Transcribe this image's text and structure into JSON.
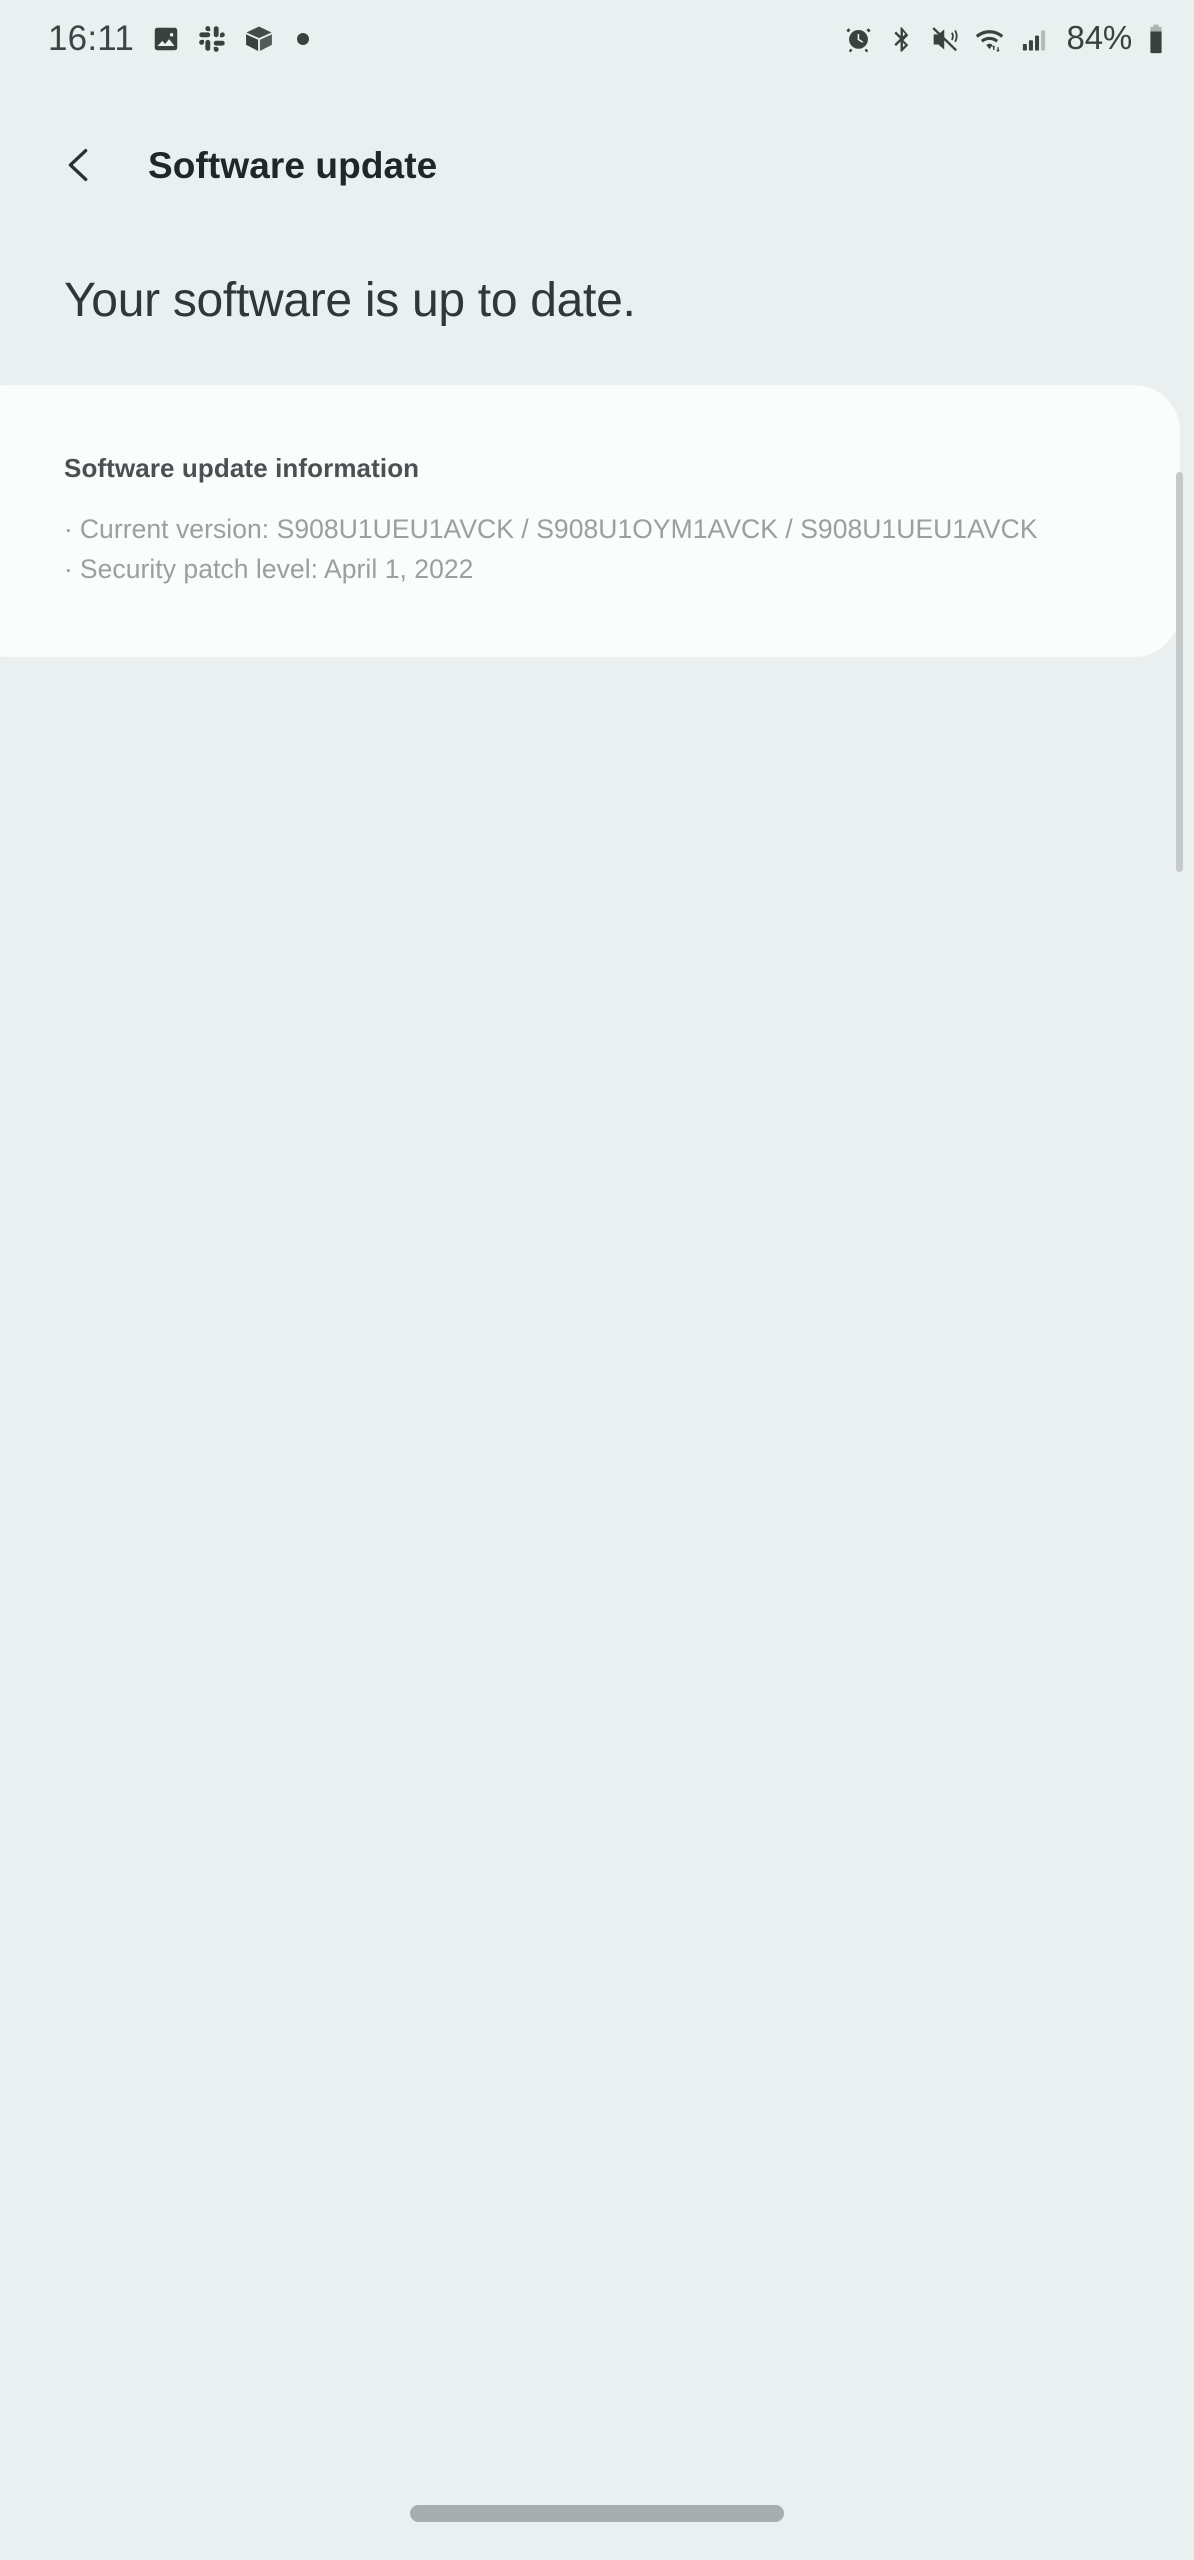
{
  "status_bar": {
    "clock": "16:11",
    "battery_percent": "84%",
    "left_icons": [
      {
        "name": "photos-icon",
        "label": "Photos"
      },
      {
        "name": "slack-icon",
        "label": "Slack"
      },
      {
        "name": "package-icon",
        "label": "Package"
      },
      {
        "name": "more-dot-icon",
        "label": "More"
      }
    ],
    "right_icons": [
      {
        "name": "alarm-icon",
        "label": "Alarm"
      },
      {
        "name": "bluetooth-icon",
        "label": "Bluetooth"
      },
      {
        "name": "mute-vibrate-icon",
        "label": "Mute"
      },
      {
        "name": "wifi-icon",
        "label": "Wi-Fi"
      },
      {
        "name": "cellular-signal-icon",
        "label": "Signal"
      },
      {
        "name": "battery-icon",
        "label": "Battery"
      }
    ]
  },
  "toolbar": {
    "back_label": "Back",
    "title": "Software update"
  },
  "main": {
    "headline": "Your software is up to date.",
    "card": {
      "title": "Software update information",
      "lines": [
        "Current version: S908U1UEU1AVCK / S908U1OYM1AVCK / S908U1UEU1AVCK",
        "Security patch level: April 1, 2022"
      ],
      "bullet_char": "·"
    }
  },
  "colors": {
    "page_background": "#e9f0ef",
    "card_background": "#fbfcfc",
    "title_text": "#20262a",
    "headline_text": "#30373a",
    "card_title_text": "#4a5153",
    "card_body_text": "#9aa0a2",
    "status_icon": "#39423f",
    "scrollbar": "#c4c9ca",
    "home_indicator": "#a8aeb0"
  },
  "navigation": {
    "home_indicator_label": "Home"
  },
  "scrollbar": {
    "label": "Page scrollbar"
  }
}
